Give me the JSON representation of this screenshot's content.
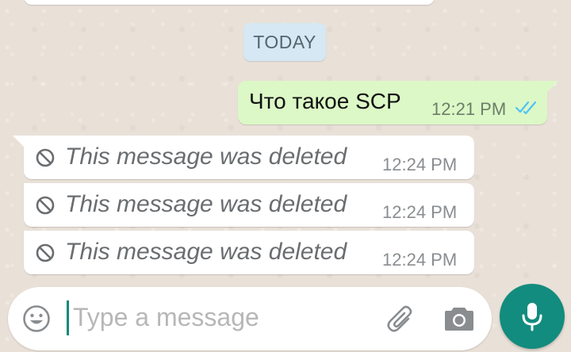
{
  "chat": {
    "date_chip": "TODAY",
    "outgoing": {
      "text": "Что такое SCP",
      "time": "12:21 PM",
      "status_icon": "double-check-read-icon"
    },
    "incoming": [
      {
        "text": "This message was deleted",
        "time": "12:24 PM",
        "icon": "ban-icon"
      },
      {
        "text": "This message was deleted",
        "time": "12:24 PM",
        "icon": "ban-icon"
      },
      {
        "text": "This message was deleted",
        "time": "12:24 PM",
        "icon": "ban-icon"
      }
    ]
  },
  "composer": {
    "placeholder": "Type a message",
    "emoji_icon": "emoji-icon",
    "attach_icon": "paperclip-icon",
    "camera_icon": "camera-icon",
    "mic_icon": "microphone-icon"
  },
  "colors": {
    "outgoing_bubble": "#dcf8c6",
    "incoming_bubble": "#ffffff",
    "date_chip": "#d5e8f3",
    "read_ticks": "#4fc3f7",
    "mic_button": "#128c7e"
  }
}
